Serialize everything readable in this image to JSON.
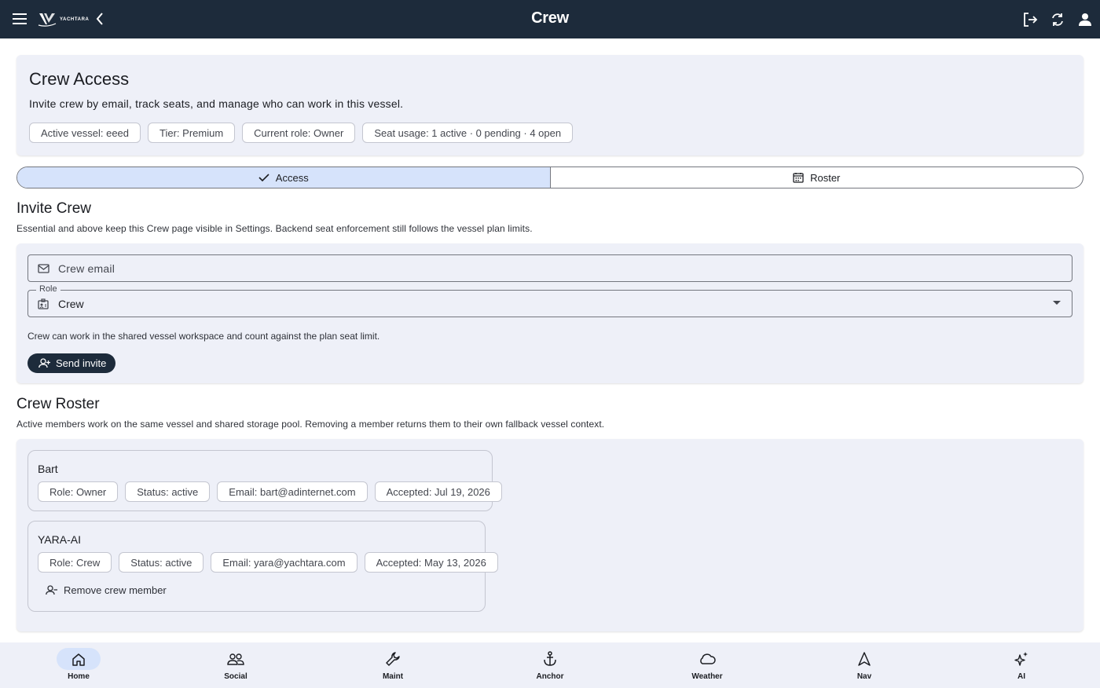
{
  "topbar": {
    "title": "Crew",
    "logo_text": "YACHTARA",
    "icons": [
      "menu-icon",
      "back-icon",
      "logout-icon",
      "sync-icon",
      "account-icon"
    ]
  },
  "access": {
    "title": "Crew Access",
    "description": "Invite crew by email, track seats, and manage who can work in this vessel.",
    "chips": [
      "Active vessel: eeed",
      "Tier: Premium",
      "Current role: Owner",
      "Seat usage: 1 active · 0 pending · 4 open"
    ]
  },
  "tabs": {
    "access_label": "Access",
    "roster_label": "Roster",
    "selected": "Access"
  },
  "invite": {
    "title": "Invite Crew",
    "subtitle": "Essential and above keep this Crew page visible in Settings. Backend seat enforcement still follows the vessel plan limits.",
    "email_placeholder": "Crew email",
    "role_label": "Role",
    "role_value": "Crew",
    "note": "Crew can work in the shared vessel workspace and count against the plan seat limit.",
    "send_label": "Send invite"
  },
  "roster": {
    "title": "Crew Roster",
    "subtitle": "Active members work on the same vessel and shared storage pool. Removing a member returns them to their own fallback vessel context.",
    "members": [
      {
        "name": "Bart",
        "chips": [
          "Role: Owner",
          "Status: active",
          "Email: bart@adinternet.com",
          "Accepted: Jul 19, 2026"
        ]
      },
      {
        "name": "YARA-AI",
        "chips": [
          "Role: Crew",
          "Status: active",
          "Email: yara@yachtara.com",
          "Accepted: May 13, 2026"
        ],
        "remove_label": "Remove crew member"
      }
    ]
  },
  "bottom_nav": {
    "items": [
      {
        "label": "Home",
        "icon": "home-icon"
      },
      {
        "label": "Social",
        "icon": "people-icon"
      },
      {
        "label": "Maint",
        "icon": "wrench-icon"
      },
      {
        "label": "Anchor",
        "icon": "anchor-icon"
      },
      {
        "label": "Weather",
        "icon": "cloud-icon"
      },
      {
        "label": "Nav",
        "icon": "navigation-icon"
      },
      {
        "label": "AI",
        "icon": "sparkle-icon"
      }
    ],
    "active": "Home"
  },
  "colors": {
    "topbar": "#1d2b3b",
    "surface": "#eef0f8",
    "accent_selected": "#d6e3fb"
  }
}
